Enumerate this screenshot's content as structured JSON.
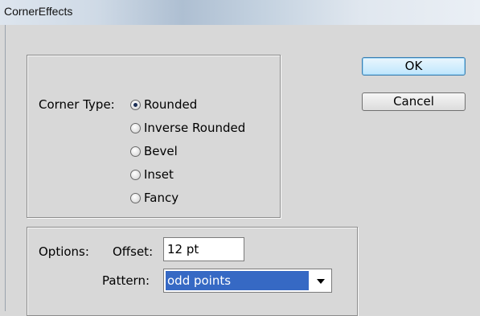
{
  "window": {
    "title": "CornerEffects"
  },
  "corner_type": {
    "label": "Corner Type:",
    "options": [
      {
        "label": "Rounded",
        "checked": true
      },
      {
        "label": "Inverse Rounded",
        "checked": false
      },
      {
        "label": "Bevel",
        "checked": false
      },
      {
        "label": "Inset",
        "checked": false
      },
      {
        "label": "Fancy",
        "checked": false
      }
    ]
  },
  "options": {
    "label": "Options:",
    "offset_label": "Offset:",
    "offset_value": "12 pt",
    "pattern_label": "Pattern:",
    "pattern_value": "odd points"
  },
  "buttons": {
    "ok": "OK",
    "cancel": "Cancel"
  }
}
